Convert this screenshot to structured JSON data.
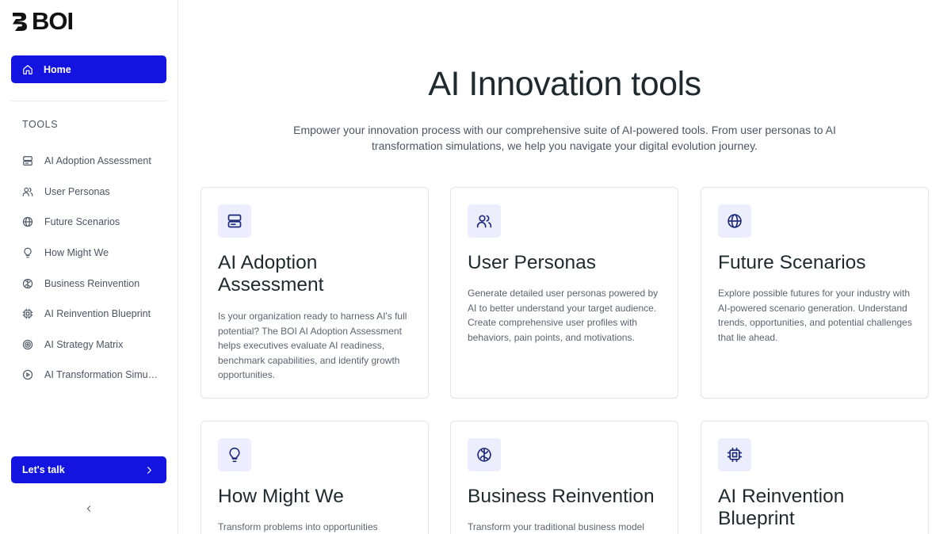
{
  "brand": {
    "name": "BOI"
  },
  "sidebar": {
    "home_label": "Home",
    "tools_heading": "TOOLS",
    "items": [
      {
        "label": "AI Adoption Assessment",
        "icon": "server-icon"
      },
      {
        "label": "User Personas",
        "icon": "users-icon"
      },
      {
        "label": "Future Scenarios",
        "icon": "globe-icon"
      },
      {
        "label": "How Might We",
        "icon": "lightbulb-icon"
      },
      {
        "label": "Business Reinvention",
        "icon": "brain-icon"
      },
      {
        "label": "AI Reinvention Blueprint",
        "icon": "cpu-icon"
      },
      {
        "label": "AI Strategy Matrix",
        "icon": "target-icon"
      },
      {
        "label": "AI Transformation Simulation",
        "icon": "play-circle-icon"
      }
    ],
    "talk_label": "Let's talk"
  },
  "main": {
    "title": "AI Innovation tools",
    "subtitle": "Empower your innovation process with our comprehensive suite of AI-powered tools. From user personas to AI transformation simulations, we help you navigate your digital evolution journey.",
    "cards": [
      {
        "title": "AI Adoption Assessment",
        "icon": "server-icon",
        "description": "Is your organization ready to harness AI's full potential? The BOI AI Adoption Assessment helps executives evaluate AI readiness, benchmark capabilities, and identify growth opportunities."
      },
      {
        "title": "User Personas",
        "icon": "users-icon",
        "description": "Generate detailed user personas powered by AI to better understand your target audience. Create comprehensive user profiles with behaviors, pain points, and motivations."
      },
      {
        "title": "Future Scenarios",
        "icon": "globe-icon",
        "description": "Explore possible futures for your industry with AI-powered scenario generation. Understand trends, opportunities, and potential challenges that lie ahead."
      },
      {
        "title": "How Might We",
        "icon": "lightbulb-icon",
        "description": "Transform problems into opportunities"
      },
      {
        "title": "Business Reinvention",
        "icon": "brain-icon",
        "description": "Transform your traditional business model"
      },
      {
        "title": "AI Reinvention Blueprint",
        "icon": "cpu-icon",
        "description": ""
      }
    ]
  },
  "colors": {
    "accent": "#1414e0",
    "icon_badge_bg": "#eceefe",
    "icon_stroke": "#1e2a78"
  }
}
